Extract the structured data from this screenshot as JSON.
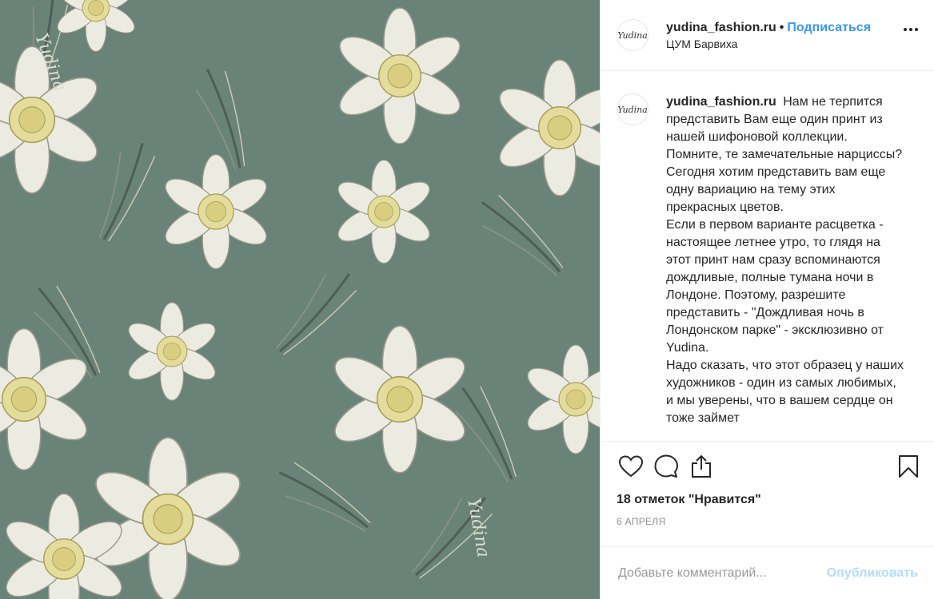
{
  "post": {
    "username": "yudina_fashion.ru",
    "separator": "•",
    "follow_label": "Подписаться",
    "location": "ЦУМ Барвиха",
    "avatar_text": "Yudina",
    "watermark": "Yudina"
  },
  "caption": {
    "username": "yudina_fashion.ru",
    "text": "Нам не терпится представить Вам еще один принт из нашей шифоновой коллекции. Помните, те замечательные нарциссы? Сегодня хотим представить вам еще одну вариацию на тему этих прекрасных цветов.\nЕсли в первом варианте расцветка - настоящее летнее утро, то глядя на этот принт нам сразу вспоминаются дождливые, полные тумана ночи в Лондоне. Поэтому, разрешите представить - \"Дождливая ночь в Лондонском парке\" - эксклюзивно от Yudina.\nНадо сказать, что этот образец у наших художников - один из самых любимых, и мы уверены, что в вашем сердце он тоже займет"
  },
  "likes": "18 отметок \"Нравится\"",
  "date": "6 АПРЕЛЯ",
  "comment": {
    "placeholder": "Добавьте комментарий...",
    "publish_label": "Опубликовать"
  },
  "colors": {
    "background_print": "#6a8378",
    "petal": "#ecebe2",
    "trumpet": "#e4dc9a",
    "follow": "#3897f0",
    "publish": "#b3dbff"
  },
  "icons": [
    "heart-icon",
    "comment-icon",
    "share-icon",
    "bookmark-icon",
    "more-icon"
  ]
}
